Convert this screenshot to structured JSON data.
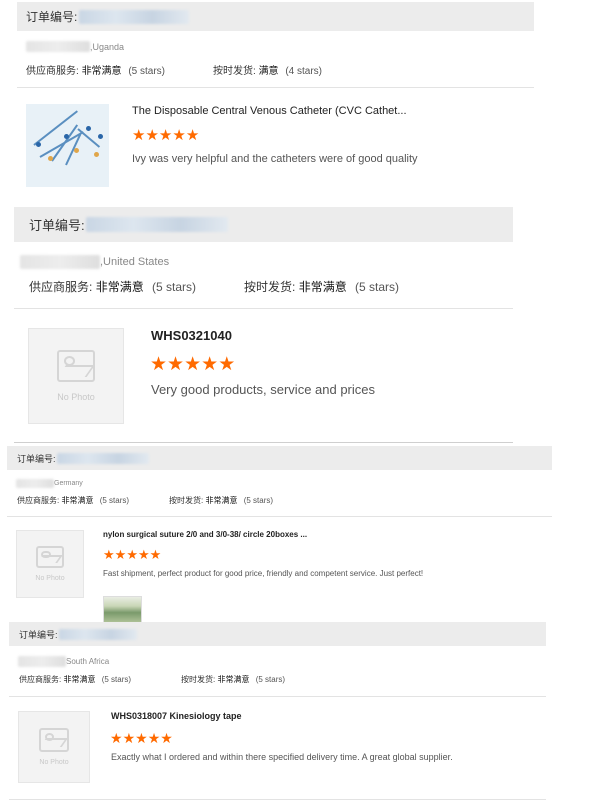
{
  "reviews": [
    {
      "order_label": "订单编号:",
      "country": ",Uganda",
      "supplier_label": "供应商服务:",
      "supplier_value": "非常满意",
      "supplier_stars": "(5 stars)",
      "delivery_label": "按时发货:",
      "delivery_value": "满意",
      "delivery_stars": "(4 stars)",
      "product_title": "The Disposable Central Venous Catheter (CVC Cathet...",
      "rating": 5,
      "comment": "Ivy was very helpful and the catheters were of good quality"
    },
    {
      "order_label": "订单编号:",
      "country": ",United States",
      "supplier_label": "供应商服务:",
      "supplier_value": "非常满意",
      "supplier_stars": "(5 stars)",
      "delivery_label": "按时发货:",
      "delivery_value": "非常满意",
      "delivery_stars": "(5 stars)",
      "product_title": "WHS0321040",
      "rating": 5,
      "comment": "Very good products, service and prices",
      "thumb_text": "No Photo"
    },
    {
      "order_label": "订单编号:",
      "country": "Germany",
      "supplier_label": "供应商服务:",
      "supplier_value": "非常满意",
      "supplier_stars": "(5 stars)",
      "delivery_label": "按时发货:",
      "delivery_value": "非常满意",
      "delivery_stars": "(5 stars)",
      "product_title": "nylon surgical suture 2/0 and 3/0-38/ circle 20boxes ...",
      "rating": 5,
      "comment": "Fast shipment, perfect product for good price, friendly and competent service. Just perfect!",
      "thumb_text": "No Photo"
    },
    {
      "order_label": "订单编号:",
      "country": "South Africa",
      "supplier_label": "供应商服务:",
      "supplier_value": "非常满意",
      "supplier_stars": "(5 stars)",
      "delivery_label": "按时发货:",
      "delivery_value": "非常满意",
      "delivery_stars": "(5 stars)",
      "product_title": "WHS0318007 Kinesiology tape",
      "rating": 5,
      "comment": "Exactly what I ordered and within there specified delivery time. A great global supplier.",
      "thumb_text": "No Photo"
    }
  ],
  "icons": {
    "star": "star-icon",
    "photo": "image-placeholder-icon"
  },
  "colors": {
    "star": "#ff6a00",
    "bar": "#ececec"
  }
}
